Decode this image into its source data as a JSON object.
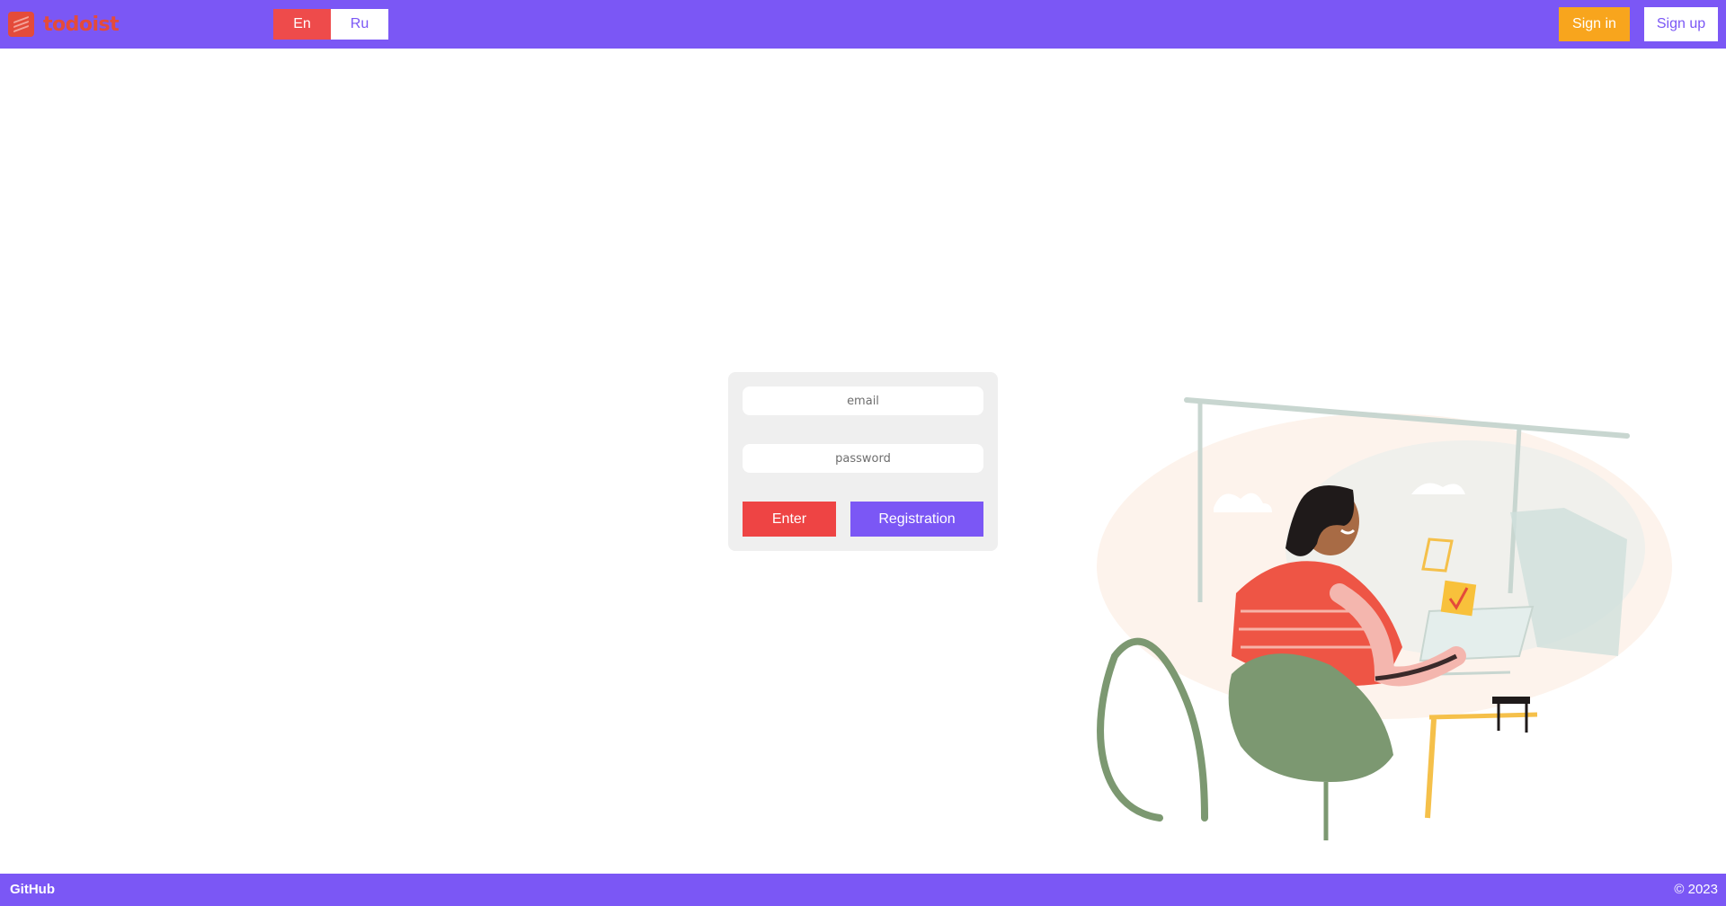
{
  "header": {
    "logo_text": "todoist",
    "languages": [
      {
        "label": "En",
        "active": true
      },
      {
        "label": "Ru",
        "active": false
      }
    ],
    "sign_in_label": "Sign in",
    "sign_up_label": "Sign up"
  },
  "login_form": {
    "email_placeholder": "email",
    "password_placeholder": "password",
    "enter_label": "Enter",
    "registration_label": "Registration"
  },
  "footer": {
    "github_label": "GitHub",
    "copyright": "© 2023"
  },
  "colors": {
    "brand_purple": "#7b57f5",
    "accent_red": "#ee4b4b",
    "sign_in_orange": "#f8a51d",
    "logo_red": "#e44b3a"
  }
}
